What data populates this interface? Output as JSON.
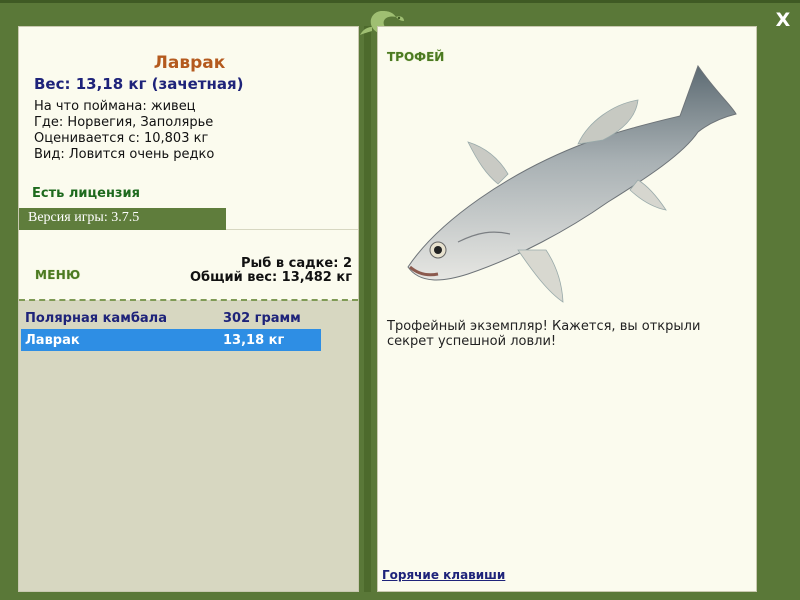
{
  "fish": {
    "name": "Лаврак",
    "weight_line": "Вес: 13,18 кг (зачетная)",
    "bait": "На что поймана: живец",
    "location": "Где: Норвегия, Заполярье",
    "valued": "Оценивается с: 10,803 кг",
    "rarity": "Вид: Ловится очень редко"
  },
  "license_text": "Есть лицензия",
  "version_text": "Версия игры: 3.7.5",
  "menu_label": "МЕНЮ",
  "stats": {
    "count": "Рыб в садке: 2",
    "total": "Общий вес: 13,482 кг"
  },
  "catch_list": [
    {
      "name": "Полярная камбала",
      "weight": "302 грамм",
      "selected": false
    },
    {
      "name": "Лаврак",
      "weight": "13,18 кг",
      "selected": true
    }
  ],
  "trophy": {
    "label": "ТРОФЕЙ",
    "text": "Трофейный экземпляр! Кажется, вы открыли секрет успешной ловли!"
  },
  "hotkeys_label": "Горячие клавиши",
  "close_label": "X",
  "icons": {
    "close": "close-icon",
    "logo": "lizard-logo-icon",
    "fish": "sea-bass-image"
  },
  "colors": {
    "frame": "#5a7838",
    "panel": "#fbfbee",
    "list_bg": "#d7d7c1",
    "title": "#b45a1e",
    "accent_text": "#1e237a",
    "selected_row": "#2e8ee4",
    "license": "#1e6a1e"
  }
}
